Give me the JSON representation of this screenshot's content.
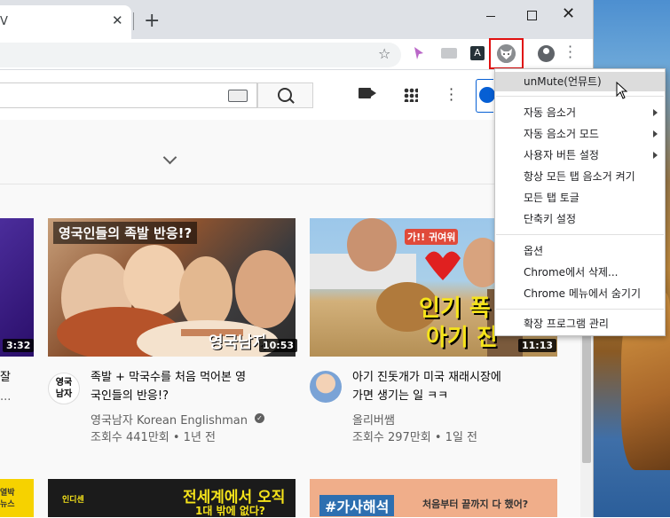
{
  "browser": {
    "tab_title": "V",
    "tab_close": "✕",
    "new_tab": "+",
    "window_controls": {
      "minimize": "minimize-icon",
      "maximize": "maximize-icon",
      "close": "✕"
    },
    "toolbar_icons": [
      "star-icon",
      "cursor-extension-icon",
      "extension-icon",
      "anchor-extension-icon",
      "unmute-extension-icon",
      "profile-icon",
      "chrome-menu-icon"
    ],
    "ext3_letter": "A"
  },
  "youtube": {
    "header_icons": [
      "keyboard-icon",
      "search-icon",
      "create-video-icon",
      "apps-icon",
      "more-icon"
    ],
    "videos": [
      {
        "thumb_caption_top": "영국인들의 족발 반응!?",
        "thumb_caption_bottom": "영국남자",
        "duration": "10:53",
        "title_line1": "족발 + 막국수를 처음 먹어본 영",
        "title_line2": "국인들의 반응!?",
        "channel": "영국남자 Korean Englishman",
        "views_age": "조회수 441만회 • 1년 전",
        "avatar_text": "영국\n남자"
      },
      {
        "thumb_caption_top": "인기 폭",
        "thumb_caption_bottom": "아기 진",
        "thumb_caption_tag": "가!! 귀여워",
        "duration": "11:13",
        "title_line1": "아기 진돗개가 미국 재래시장에",
        "title_line2": "가면 생기는 일 ㅋㅋ",
        "channel": "올리버쌤",
        "views_age": "조회수 297만회 • 1일 전"
      }
    ],
    "left_partial": {
      "duration": "3:32",
      "title_fragment": "잘",
      "meta_fragment": "..."
    },
    "bottom_row": {
      "left_tag": "열박\n뉴스",
      "center_top": "전세계에서 오직",
      "center_bottom": "1대 밖에 없다?",
      "center_badge": "인디센",
      "right_tag": "#가사해석",
      "right_text": "처음부터 끝까지 다 했어?"
    }
  },
  "context_menu": {
    "items": [
      {
        "label": "unMute(언뮤트)",
        "highlighted": true
      },
      {
        "label": "자동 음소거",
        "submenu": true
      },
      {
        "label": "자동 음소거 모드",
        "submenu": true
      },
      {
        "label": "사용자 버튼 설정",
        "submenu": true
      },
      {
        "label": "항상 모든 탭 음소거 켜기"
      },
      {
        "label": "모든 탭 토글"
      },
      {
        "label": "단축키 설정"
      },
      {
        "label": "옵션"
      },
      {
        "label": "Chrome에서 삭제..."
      },
      {
        "label": "Chrome 메뉴에서 숨기기"
      },
      {
        "label": "확장 프로그램 관리"
      }
    ]
  },
  "colors": {
    "highlight_frame": "#e01010",
    "menu_highlight": "#dcdcdc",
    "thumbnail_text_yellow": "#f5e31a"
  }
}
